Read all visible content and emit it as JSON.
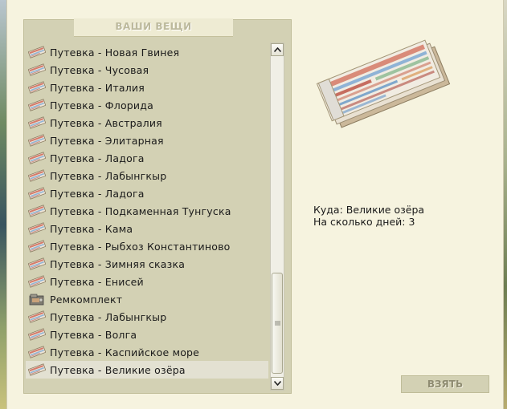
{
  "panel": {
    "title": "ВАШИ ВЕЩИ"
  },
  "items": [
    {
      "label": "Путевка - Новая Гвинея",
      "icon": "ticket-icon"
    },
    {
      "label": "Путевка - Чусовая",
      "icon": "ticket-icon"
    },
    {
      "label": "Путевка - Италия",
      "icon": "ticket-icon"
    },
    {
      "label": "Путевка - Флорида",
      "icon": "ticket-icon"
    },
    {
      "label": "Путевка - Австралия",
      "icon": "ticket-icon"
    },
    {
      "label": "Путевка - Элитарная",
      "icon": "ticket-icon"
    },
    {
      "label": "Путевка - Ладога",
      "icon": "ticket-icon"
    },
    {
      "label": "Путевка - Лабынгкыр",
      "icon": "ticket-icon"
    },
    {
      "label": "Путевка - Ладога",
      "icon": "ticket-icon"
    },
    {
      "label": "Путевка - Подкаменная Тунгуска",
      "icon": "ticket-icon"
    },
    {
      "label": "Путевка - Кама",
      "icon": "ticket-icon"
    },
    {
      "label": "Путевка - Рыбхоз Константиново",
      "icon": "ticket-icon"
    },
    {
      "label": "Путевка - Зимняя сказка",
      "icon": "ticket-icon"
    },
    {
      "label": "Путевка - Енисей",
      "icon": "ticket-icon"
    },
    {
      "label": "Ремкомплект",
      "icon": "repair-kit-icon"
    },
    {
      "label": "Путевка - Лабынгкыр",
      "icon": "ticket-icon"
    },
    {
      "label": "Путевка - Волга",
      "icon": "ticket-icon"
    },
    {
      "label": "Путевка - Каспийское море",
      "icon": "ticket-icon"
    },
    {
      "label": "Путевка - Великие озёра",
      "icon": "ticket-icon",
      "selected": true
    }
  ],
  "details": {
    "destination": "Куда: Великие озёра",
    "days": "На сколько дней: 3"
  },
  "buttons": {
    "take": "ВЗЯТЬ"
  },
  "scrollbar": {
    "position": 0.75
  },
  "colors": {
    "panel_bg": "#d3d1b4",
    "page_bg": "#f6f3df",
    "selected_bg": "#e3e1d2"
  }
}
